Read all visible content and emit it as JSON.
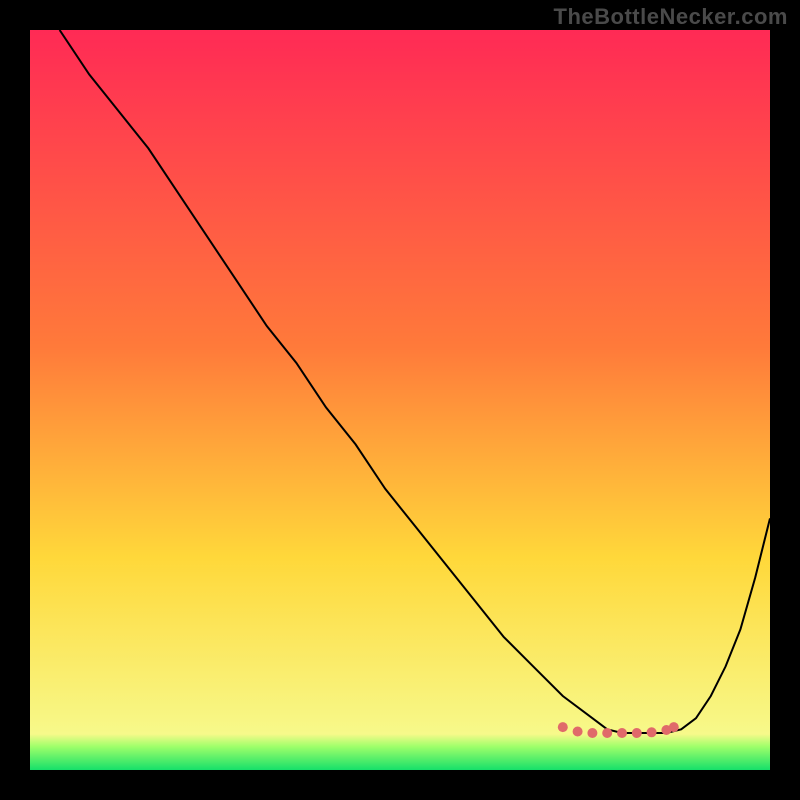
{
  "watermark": "TheBottleNecker.com",
  "colors": {
    "frame": "#000000",
    "heat_top": "#ff2a55",
    "heat_mid1": "#ff7a3a",
    "heat_mid2": "#ffd83a",
    "heat_bottom": "#f7f98a",
    "green_top": "#9eff6a",
    "green_bottom": "#16e06a",
    "curve": "#000000",
    "dots": "#e06a6a"
  },
  "chart_data": {
    "type": "line",
    "title": "",
    "xlabel": "",
    "ylabel": "",
    "xlim": [
      0,
      100
    ],
    "ylim": [
      0,
      100
    ],
    "grid": false,
    "legend": false,
    "series": [
      {
        "name": "bottleneck-curve",
        "x": [
          4,
          8,
          12,
          16,
          20,
          24,
          28,
          32,
          36,
          40,
          44,
          48,
          52,
          56,
          60,
          64,
          68,
          72,
          76,
          78,
          80,
          82,
          84,
          86,
          88,
          90,
          92,
          94,
          96,
          98,
          100
        ],
        "y": [
          100,
          94,
          89,
          84,
          78,
          72,
          66,
          60,
          55,
          49,
          44,
          38,
          33,
          28,
          23,
          18,
          14,
          10,
          7,
          5.5,
          5,
          5,
          5,
          5,
          5.5,
          7,
          10,
          14,
          19,
          26,
          34
        ]
      }
    ],
    "marker_points": {
      "name": "optimal-zone-dots",
      "x": [
        72,
        74,
        76,
        78,
        80,
        82,
        84,
        86,
        87
      ],
      "y": [
        5.8,
        5.2,
        5.0,
        5.0,
        5.0,
        5.0,
        5.1,
        5.4,
        5.8
      ]
    }
  }
}
